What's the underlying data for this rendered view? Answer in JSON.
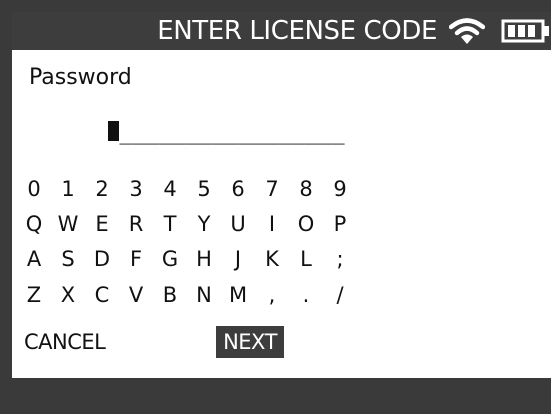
{
  "header": {
    "title": "ENTER LICENSE CODE",
    "wifi_icon": "wifi-icon",
    "battery_icon": "battery-full-icon"
  },
  "form": {
    "label": "Password",
    "cursor_char": "_",
    "value_placeholder": "_________________"
  },
  "keyboard": {
    "rows": [
      [
        "0",
        "1",
        "2",
        "3",
        "4",
        "5",
        "6",
        "7",
        "8",
        "9"
      ],
      [
        "Q",
        "W",
        "E",
        "R",
        "T",
        "Y",
        "U",
        "I",
        "O",
        "P"
      ],
      [
        "A",
        "S",
        "D",
        "F",
        "G",
        "H",
        "J",
        "K",
        "L",
        ";"
      ],
      [
        "Z",
        "X",
        "C",
        "V",
        "B",
        "N",
        "M",
        ",",
        ".",
        "/"
      ]
    ]
  },
  "actions": {
    "cancel_label": "CANCEL",
    "next_label": "NEXT"
  },
  "colors": {
    "frame": "#3a3a3a",
    "header_bg": "#3d3d3d",
    "content_bg": "#ffffff",
    "text": "#111111",
    "highlight_bg": "#3d3d3d",
    "highlight_text": "#ffffff"
  }
}
